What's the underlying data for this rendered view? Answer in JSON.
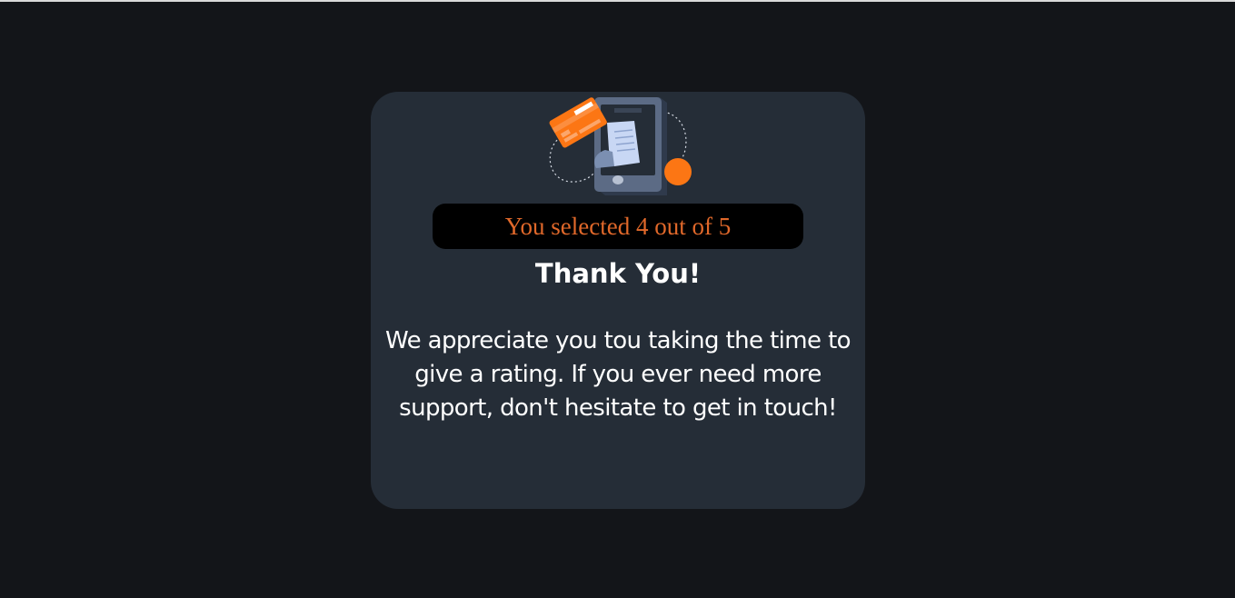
{
  "thank_you": {
    "rating_text": "You selected 4 out of 5",
    "title": "Thank You!",
    "message": "We appreciate you tou taking the time to give a rating. If you ever need more support, don't hesitate to get in touch!"
  },
  "colors": {
    "page_background": "#131519",
    "card_background": "#252d37",
    "accent": "#fc7614",
    "rating_text": "#e0682a"
  },
  "icons": {
    "illustration": "payment-receipt-phone-icon"
  }
}
